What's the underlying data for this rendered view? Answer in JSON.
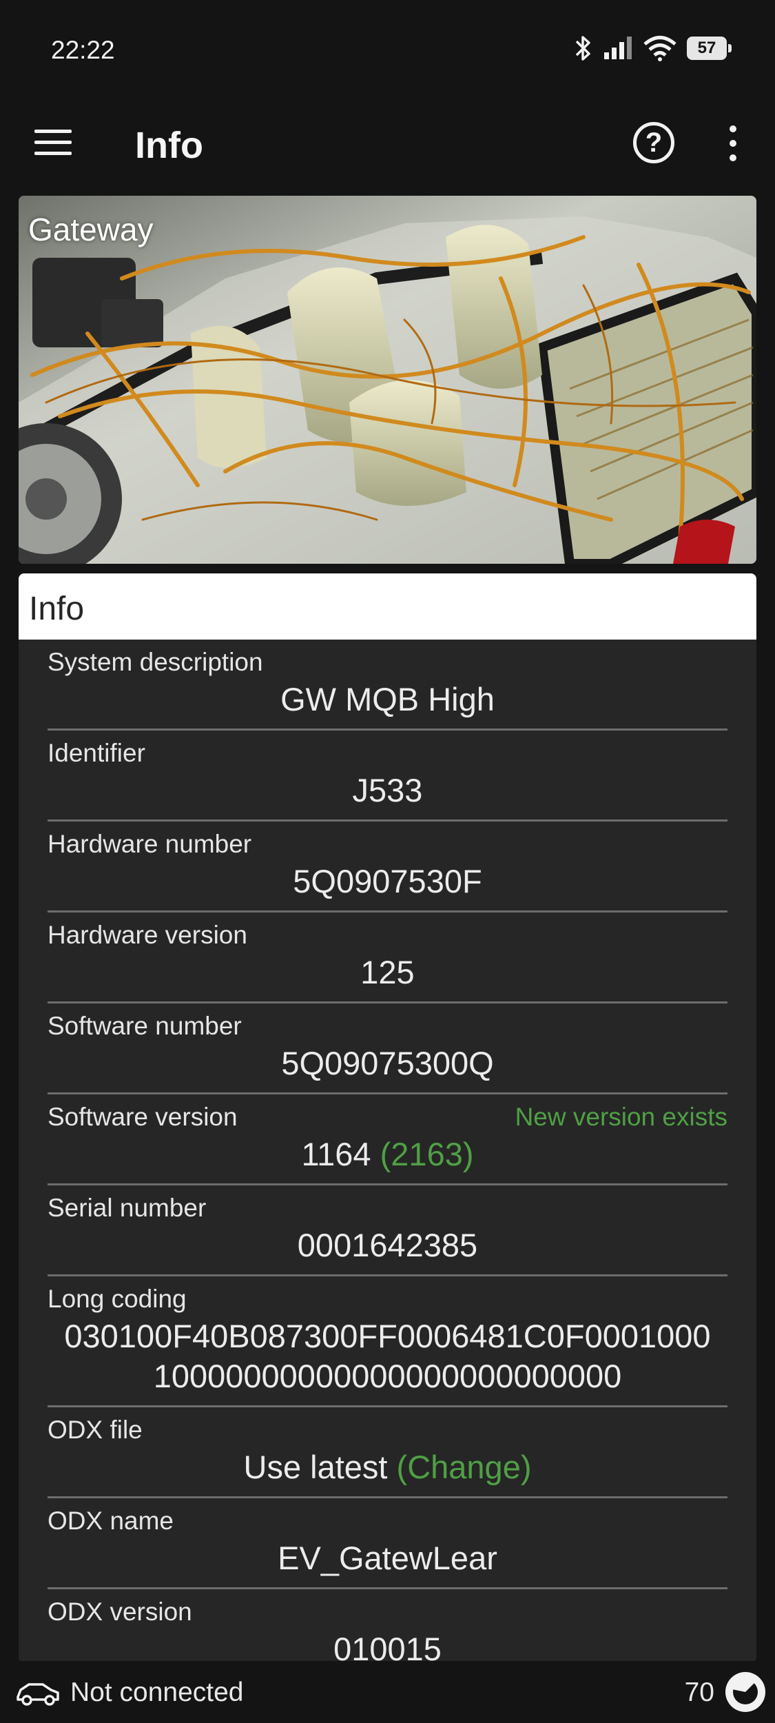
{
  "status_bar": {
    "time": "22:22",
    "battery": "57",
    "icons": [
      "bluetooth-icon",
      "signal-icon",
      "wifi-icon",
      "battery-icon"
    ]
  },
  "app_bar": {
    "title": "Info",
    "icons": [
      "menu-icon",
      "help-icon",
      "more-vert-icon"
    ]
  },
  "hero": {
    "label": "Gateway"
  },
  "card": {
    "header": "Info",
    "rows": [
      {
        "label": "System description",
        "value": "GW MQB High"
      },
      {
        "label": "Identifier",
        "value": "J533"
      },
      {
        "label": "Hardware number",
        "value": "5Q0907530F"
      },
      {
        "label": "Hardware version",
        "value": "125"
      },
      {
        "label": "Software number",
        "value": "5Q09075300Q"
      },
      {
        "label": "Software version",
        "value": "1164",
        "value_extra": "(2163)",
        "note": "New version exists"
      },
      {
        "label": "Serial number",
        "value": "0001642385"
      },
      {
        "label": "Long coding",
        "value_line1": "030100F40B087300FF0006481C0F0001000",
        "value_line2": "10000000000000000000000000"
      },
      {
        "label": "ODX file",
        "value": "Use latest",
        "value_extra": "(Change)"
      },
      {
        "label": "ODX name",
        "value": "EV_GatewLear"
      },
      {
        "label": "ODX version",
        "value": "010015"
      }
    ]
  },
  "bottom_bar": {
    "connection": "Not connected",
    "count": "70"
  },
  "colors": {
    "background": "#141414",
    "card": "#262626",
    "accent_green": "#4fa045",
    "divider": "#6d6d6d"
  }
}
